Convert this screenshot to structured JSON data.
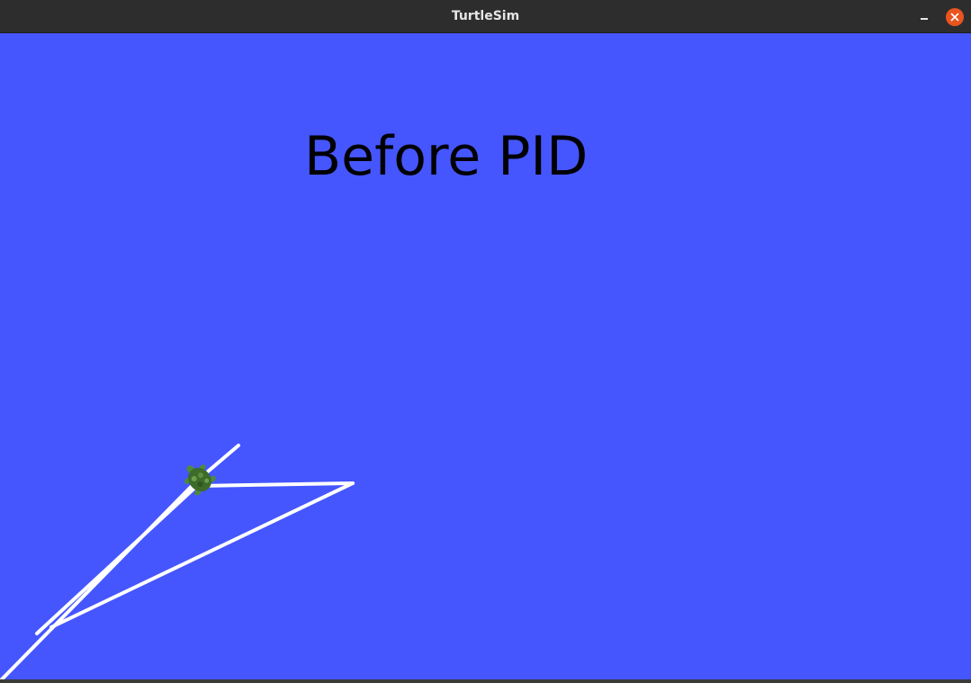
{
  "window": {
    "title": "TurtleSim"
  },
  "canvas": {
    "background_color": "#4556ff",
    "pen_color": "#ffffff",
    "overlay_text": "Before PID"
  },
  "controls": {
    "minimize_icon": "minimize-icon",
    "close_icon": "close-icon",
    "close_color": "#e9541f"
  },
  "turtle": {
    "icon": "turtle-icon"
  }
}
